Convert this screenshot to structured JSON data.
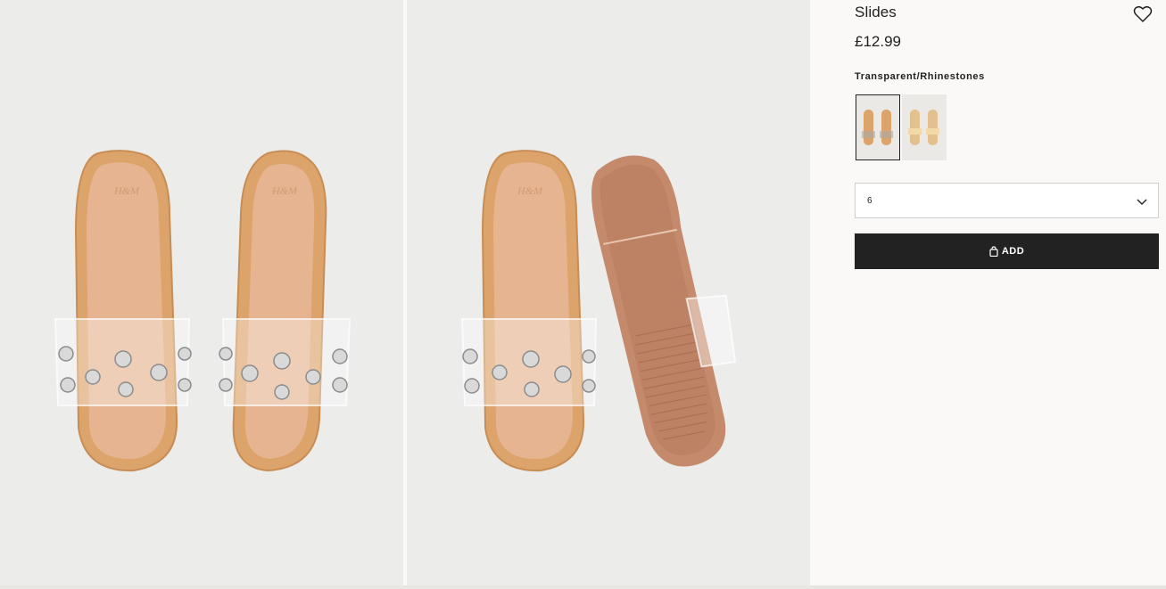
{
  "product": {
    "title": "Slides",
    "price": "£12.99",
    "color_name": "Transparent/Rhinestones",
    "size_selected": "6",
    "add_label": "ADD"
  },
  "gallery": {
    "image_1": "Pair of transparent rhinestone slides, top view",
    "image_2": "Rhinestone slides, one showing the sole"
  },
  "icons": {
    "favorite": "heart-icon",
    "dropdown": "chevron-down-icon",
    "bag": "bag-icon"
  },
  "colors": {
    "button_bg": "#222222",
    "page_bg": "#faf9f8",
    "photo_bg": "#ececeb",
    "insole": "#e3b28b",
    "sole": "#c58a6c"
  }
}
